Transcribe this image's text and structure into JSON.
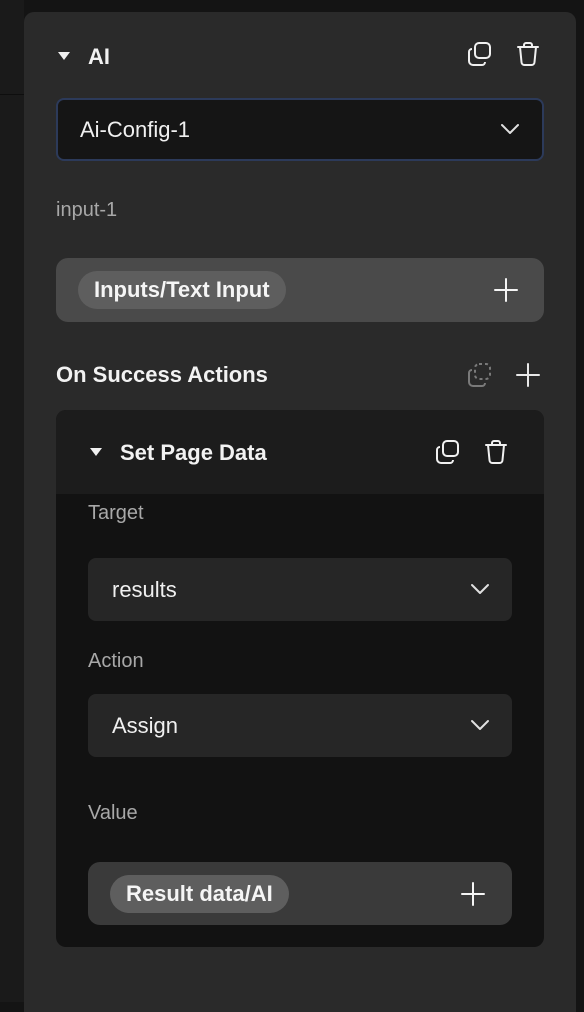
{
  "section": {
    "title": "AI",
    "config_select": {
      "value": "Ai-Config-1"
    },
    "input_label": "input-1",
    "input_pill": "Inputs/Text Input"
  },
  "on_success": {
    "title": "On Success Actions",
    "action_card": {
      "title": "Set Page Data",
      "target_label": "Target",
      "target_value": "results",
      "action_label": "Action",
      "action_value": "Assign",
      "value_label": "Value",
      "value_pill": "Result data/AI"
    }
  },
  "icons": [
    "caret-down-icon",
    "copy-icon",
    "trash-icon",
    "chevron-down-icon",
    "plus-icon",
    "paste-icon"
  ],
  "colors": {
    "panel": "#2a2a2a",
    "card": "#121212",
    "select_border": "#2c3a5a",
    "pill": "#5e5e5e"
  }
}
